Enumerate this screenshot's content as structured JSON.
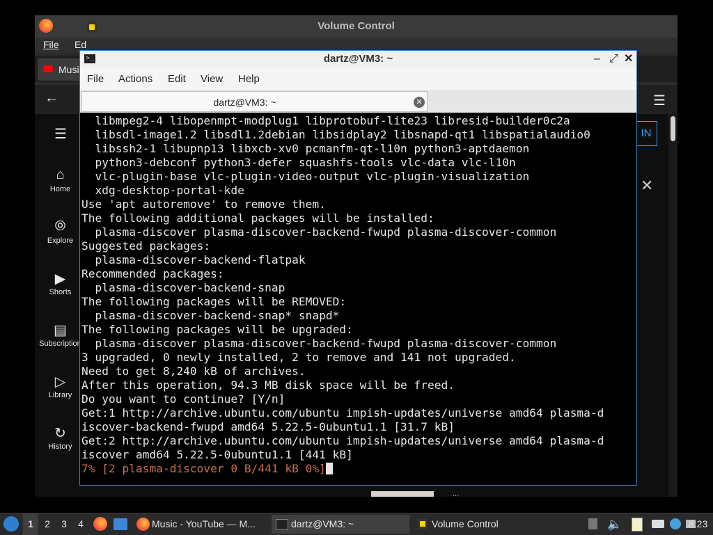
{
  "background_window": {
    "title": "Volume Control",
    "menu": [
      "File",
      "Ed"
    ],
    "tab_label": "Musi",
    "signin_label": "IN",
    "bottom_text": "...",
    "sidebar": [
      {
        "label": "Home",
        "icon": "home-icon"
      },
      {
        "label": "Explore",
        "icon": "compass-icon"
      },
      {
        "label": "Shorts",
        "icon": "shorts-icon"
      },
      {
        "label": "Subscription",
        "icon": "subscriptions-icon"
      },
      {
        "label": "Library",
        "icon": "library-icon"
      },
      {
        "label": "History",
        "icon": "history-icon"
      }
    ]
  },
  "terminal": {
    "title": "dartz@VM3: ~",
    "menu": [
      "File",
      "Actions",
      "Edit",
      "View",
      "Help"
    ],
    "tab_label": "dartz@VM3: ~",
    "output": "  libmpeg2-4 libopenmpt-modplug1 libprotobuf-lite23 libresid-builder0c2a\n  libsdl-image1.2 libsdl1.2debian libsidplay2 libsnapd-qt1 libspatialaudio0\n  libssh2-1 libupnp13 libxcb-xv0 pcmanfm-qt-l10n python3-aptdaemon\n  python3-debconf python3-defer squashfs-tools vlc-data vlc-l10n\n  vlc-plugin-base vlc-plugin-video-output vlc-plugin-visualization\n  xdg-desktop-portal-kde\nUse 'apt autoremove' to remove them.\nThe following additional packages will be installed:\n  plasma-discover plasma-discover-backend-fwupd plasma-discover-common\nSuggested packages:\n  plasma-discover-backend-flatpak\nRecommended packages:\n  plasma-discover-backend-snap\nThe following packages will be REMOVED:\n  plasma-discover-backend-snap* snapd*\nThe following packages will be upgraded:\n  plasma-discover plasma-discover-backend-fwupd plasma-discover-common\n3 upgraded, 0 newly installed, 2 to remove and 141 not upgraded.\nNeed to get 8,240 kB of archives.\nAfter this operation, 94.3 MB disk space will be freed.\nDo you want to continue? [Y/n]\nGet:1 http://archive.ubuntu.com/ubuntu impish-updates/universe amd64 plasma-d\niscover-backend-fwupd amd64 5.22.5-0ubuntu1.1 [31.7 kB]\nGet:2 http://archive.ubuntu.com/ubuntu impish-updates/universe amd64 plasma-d\niscover amd64 5.22.5-0ubuntu1.1 [441 kB]\n",
    "progress": "7% [2 plasma-discover 0 B/441 kB 0%]"
  },
  "taskbar": {
    "workspaces": [
      "1",
      "2",
      "3",
      "4"
    ],
    "tasks": [
      {
        "label": "Music - YouTube — M...",
        "icon": "firefox-icon"
      },
      {
        "label": "dartz@VM3: ~",
        "icon": "terminal-icon"
      },
      {
        "label": "Volume Control",
        "icon": "volume-control-icon"
      }
    ],
    "clock": "8:23"
  },
  "colors": {
    "accent": "#3c7dbb",
    "progress_text": "#c8704a",
    "taskbar_bg": "#2a2a2a"
  }
}
